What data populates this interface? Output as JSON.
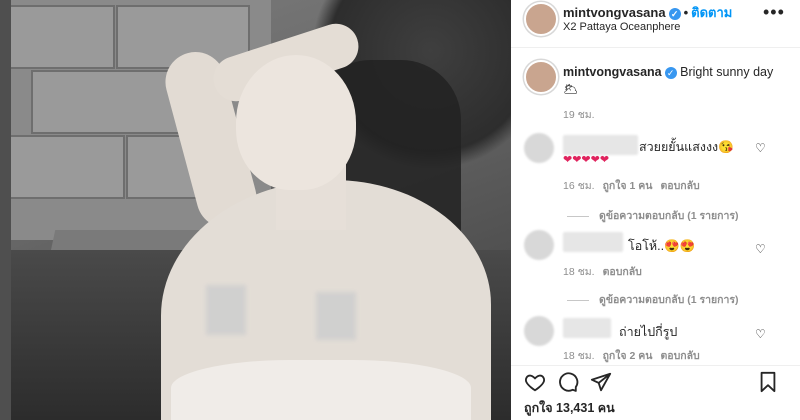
{
  "post": {
    "username": "mintvongvasana",
    "follow_label": "ติดตาม",
    "location": "X2 Pattaya Oceanphere",
    "more_label": "•••"
  },
  "caption": {
    "username": "mintvongvasana",
    "text": "Bright sunny day",
    "emoji": "🌥",
    "time": "19 ชม."
  },
  "comments": [
    {
      "text": "สวยยยั้นแสงงง😘",
      "hearts": "❤❤❤❤❤",
      "time": "16 ชม.",
      "likes": "ถูกใจ 1 คน",
      "reply_label": "ตอบกลับ",
      "view_replies": "ดูข้อความตอบกลับ (1 รายการ)"
    },
    {
      "text": "โอโห้..😍😍",
      "time": "18 ชม.",
      "reply_label": "ตอบกลับ",
      "view_replies": "ดูข้อความตอบกลับ (1 รายการ)"
    },
    {
      "text": "ถ่ายไปกี่รูป",
      "time": "18 ชม.",
      "likes": "ถูกใจ 2 คน",
      "reply_label": "ตอบกลับ"
    }
  ],
  "likes_summary": "ถูกใจ 13,431 คน",
  "icons": {
    "like": "heart-icon",
    "comment": "comment-icon",
    "share": "share-icon",
    "save": "bookmark-icon",
    "more": "more-options-icon",
    "verified": "verified-badge-icon"
  },
  "colors": {
    "accent": "#0095f6",
    "verified": "#3897f0",
    "text": "#262626",
    "secondary": "#8e8e8e"
  }
}
